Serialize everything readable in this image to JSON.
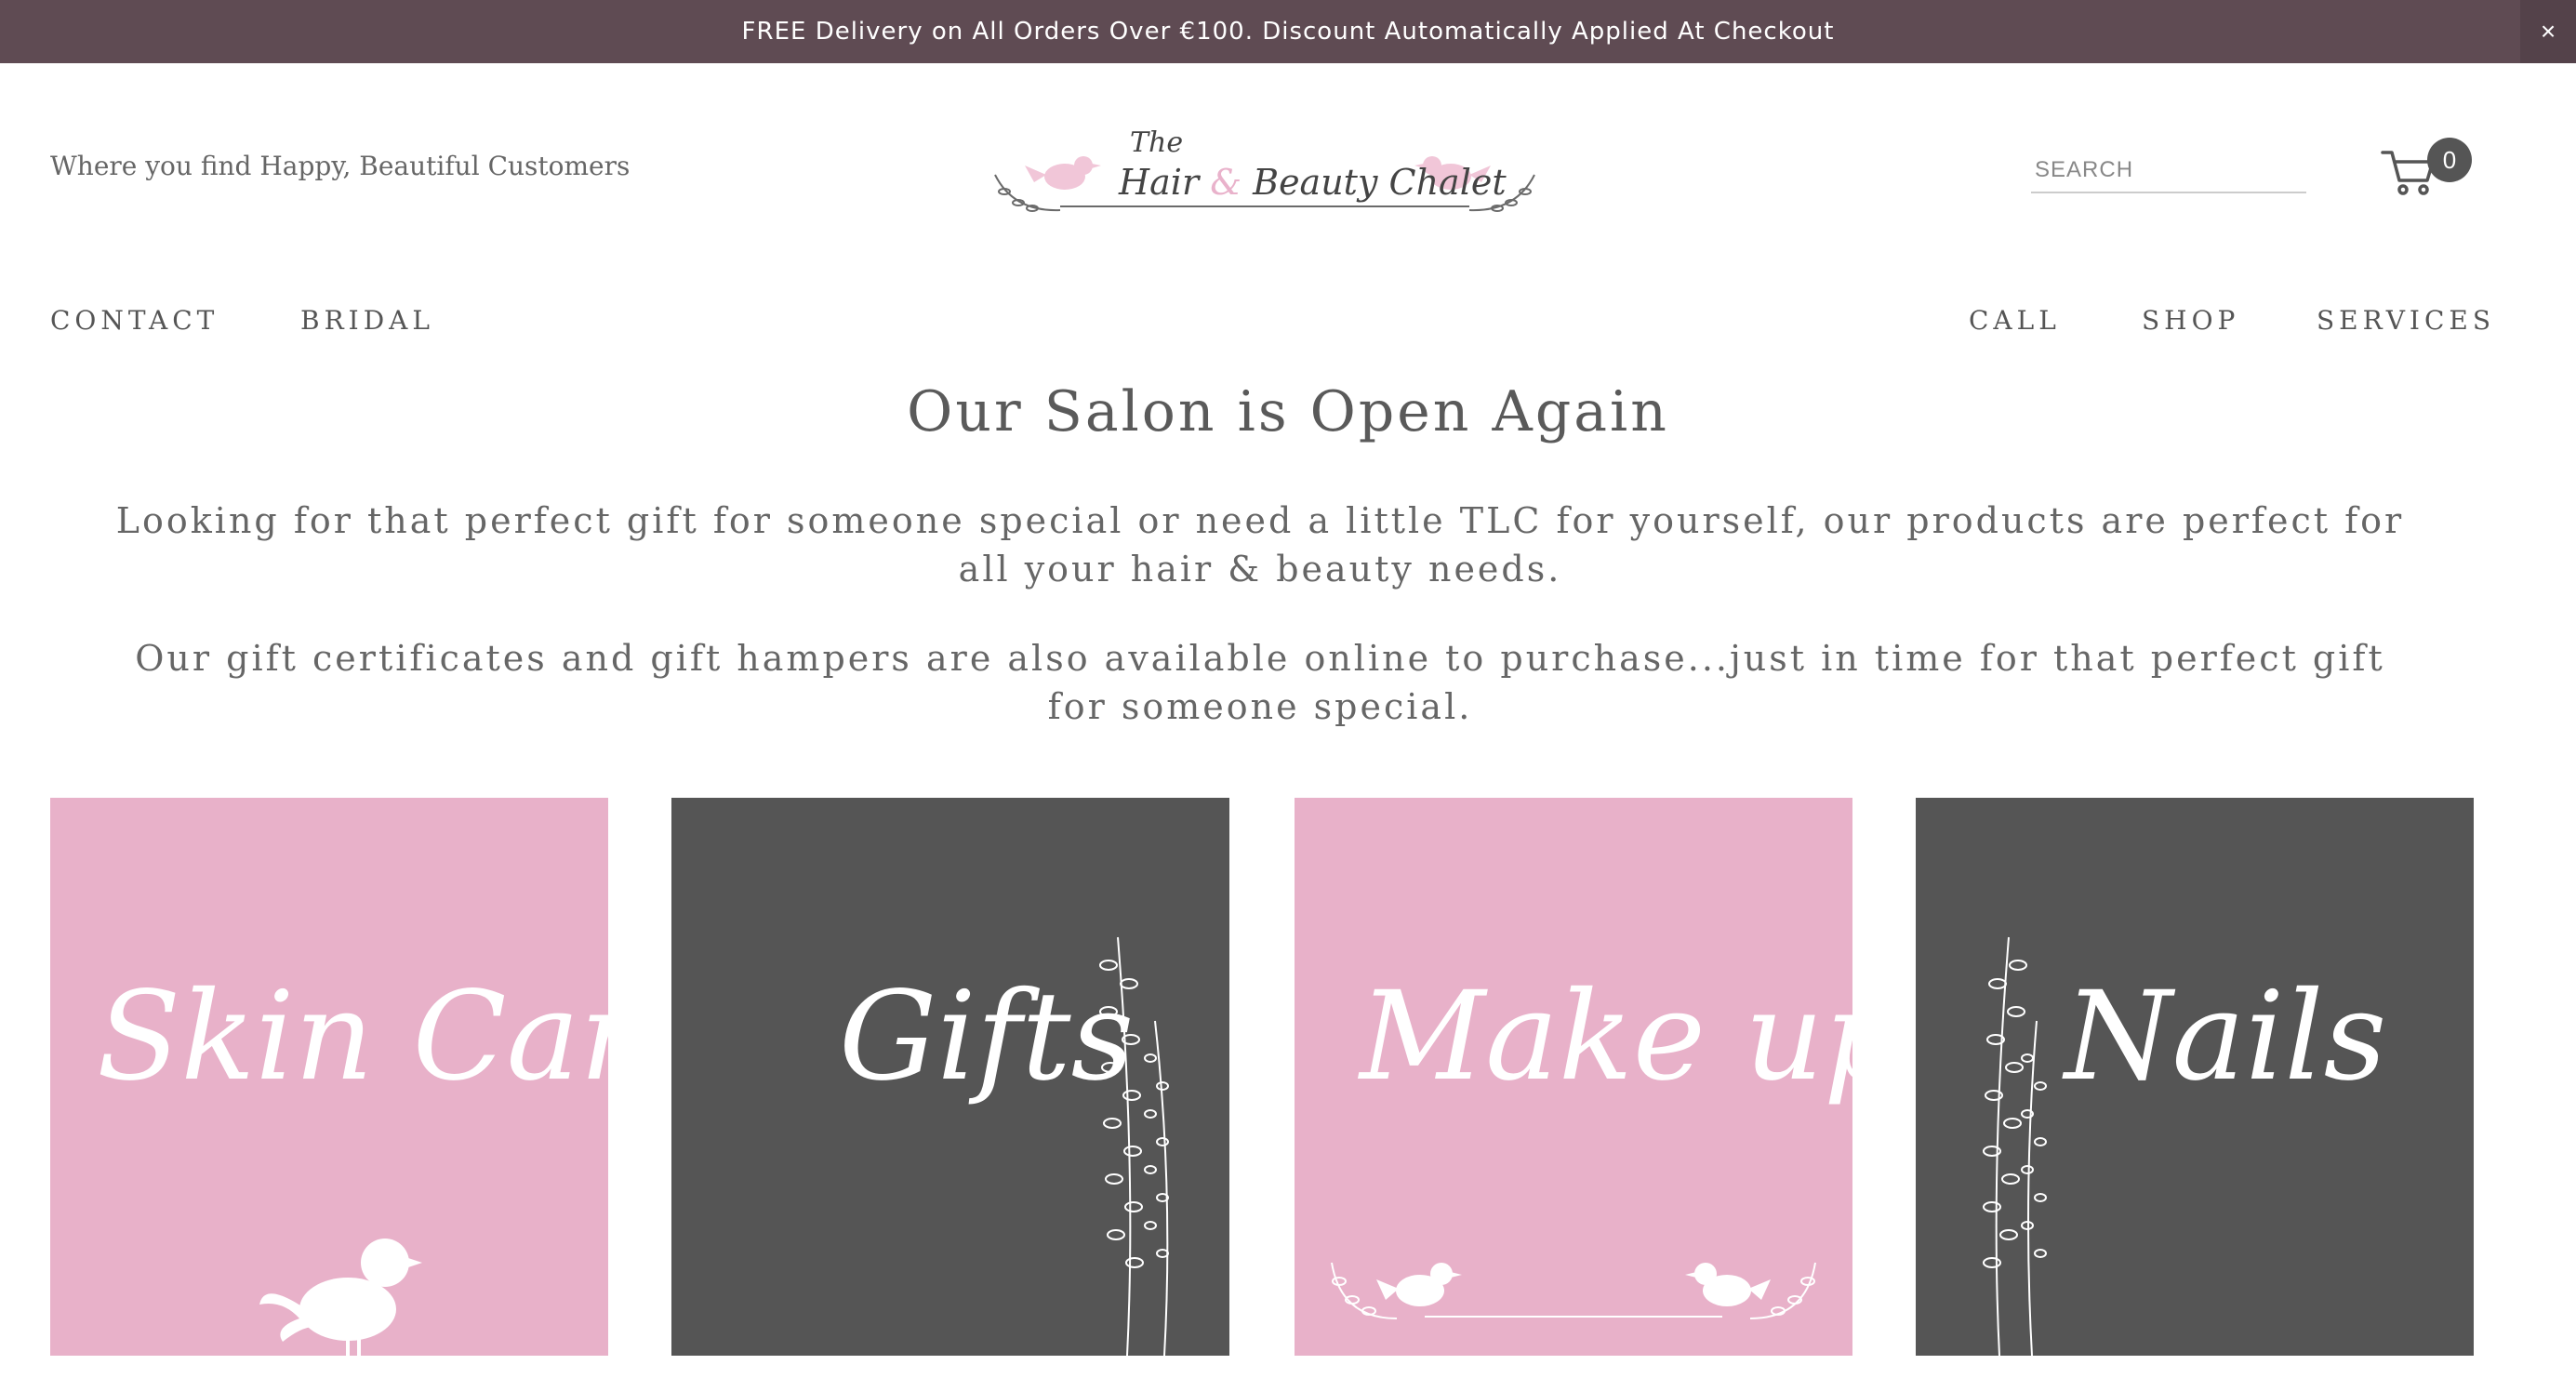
{
  "announcement": {
    "text": "FREE Delivery on All Orders Over €100. Discount Automatically Applied At Checkout",
    "close_label": "×"
  },
  "header": {
    "tagline": "Where you find Happy, Beautiful Customers",
    "logo": {
      "line1": "The",
      "word1": "Hair",
      "amp": "&",
      "word2": "Beauty Chalet"
    },
    "search_placeholder": "SEARCH",
    "cart_count": "0"
  },
  "nav": {
    "left": [
      "CONTACT",
      "BRIDAL"
    ],
    "right": [
      "CALL",
      "SHOP",
      "SERVICES"
    ]
  },
  "main": {
    "heading": "Our Salon is Open Again",
    "paragraphs": [
      "Looking for that perfect gift for someone special or need a little TLC for yourself, our products are perfect for all your hair & beauty needs.",
      "Our gift certificates and gift hampers are also available online to purchase...just in time for that perfect gift for someone special."
    ]
  },
  "tiles": [
    {
      "title": "Skin Care",
      "bg": "#e8b1c9"
    },
    {
      "title": "Gifts",
      "bg": "#555555"
    },
    {
      "title": "Make up",
      "bg": "#e8b1c9"
    },
    {
      "title": "Nails",
      "bg": "#555555"
    }
  ],
  "colors": {
    "announce_bg": "#5f4b53",
    "pink": "#e8b1c9",
    "dark": "#555555"
  }
}
